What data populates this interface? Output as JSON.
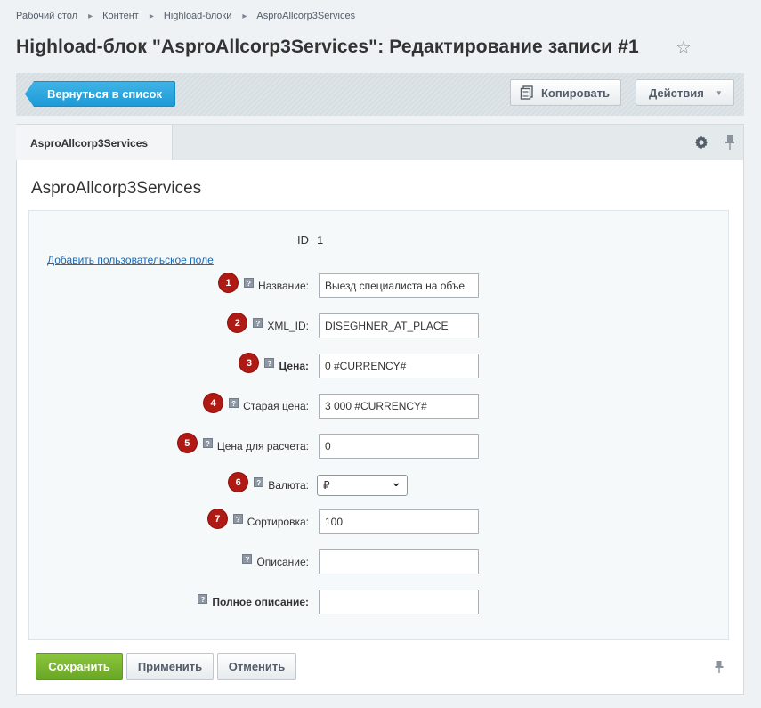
{
  "breadcrumbs": [
    "Рабочий стол",
    "Контент",
    "Highload-блоки",
    "AsproAllcorp3Services"
  ],
  "title": "Highload-блок \"AsproAllcorp3Services\": Редактирование записи #1",
  "toolbar": {
    "back_label": "Вернуться в список",
    "copy_label": "Копировать",
    "actions_label": "Действия"
  },
  "tab": {
    "label": "AsproAllcorp3Services"
  },
  "section_title": "AsproAllcorp3Services",
  "id_field": {
    "label": "ID",
    "value": "1"
  },
  "add_field_link": "Добавить пользовательское поле",
  "fields": [
    {
      "badge": "1",
      "label": "Название:",
      "value": "Выезд специалиста на объе",
      "bold": false,
      "kind": "input"
    },
    {
      "badge": "2",
      "label": "XML_ID:",
      "value": "DISEGHNER_AT_PLACE",
      "bold": false,
      "kind": "input"
    },
    {
      "badge": "3",
      "label": "Цена:",
      "value": "0 #CURRENCY#",
      "bold": true,
      "kind": "input"
    },
    {
      "badge": "4",
      "label": "Старая цена:",
      "value": "3 000 #CURRENCY#",
      "bold": false,
      "kind": "input"
    },
    {
      "badge": "5",
      "label": "Цена для расчета:",
      "value": "0",
      "bold": false,
      "kind": "input"
    },
    {
      "badge": "6",
      "label": "Валюта:",
      "value": "₽",
      "bold": false,
      "kind": "select"
    },
    {
      "badge": "7",
      "label": "Сортировка:",
      "value": "100",
      "bold": false,
      "kind": "input"
    },
    {
      "badge": "",
      "label": "Описание:",
      "value": "",
      "bold": false,
      "kind": "input"
    },
    {
      "badge": "",
      "label": "Полное описание:",
      "value": "",
      "bold": true,
      "kind": "input"
    }
  ],
  "help_glyph": "?",
  "footer": {
    "save_label": "Сохранить",
    "apply_label": "Применить",
    "cancel_label": "Отменить"
  },
  "colors": {
    "accent_blue": "#1d9ad7",
    "save_green": "#6aa726",
    "badge_red": "#b01a14"
  }
}
